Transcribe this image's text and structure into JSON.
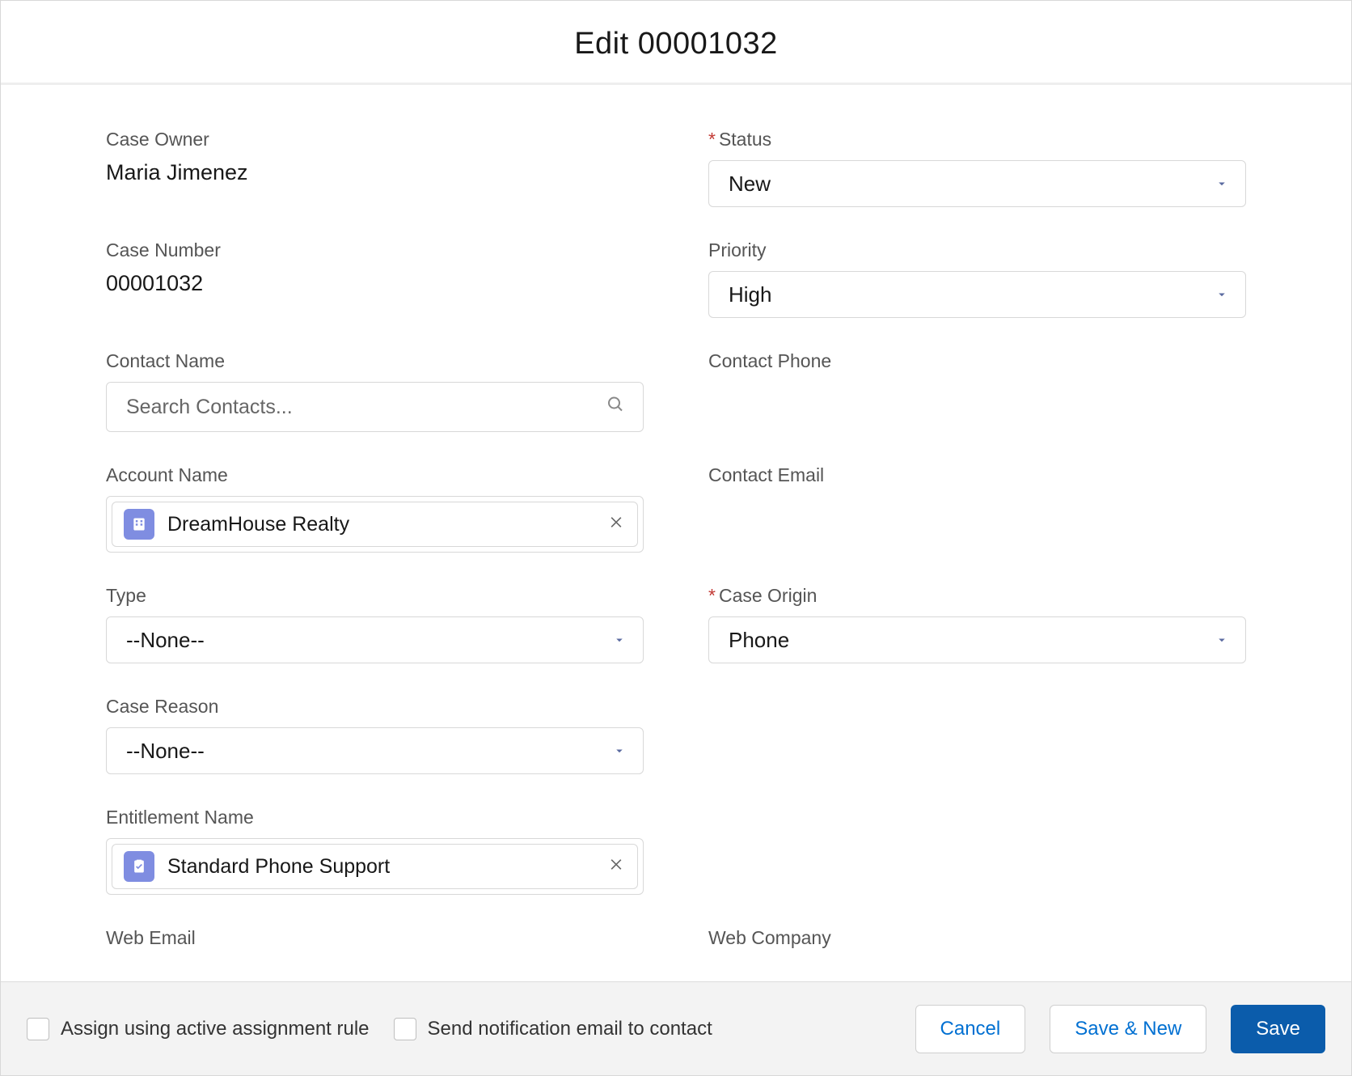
{
  "header": {
    "title": "Edit 00001032"
  },
  "fields": {
    "caseOwner": {
      "label": "Case Owner",
      "value": "Maria Jimenez"
    },
    "status": {
      "label": "Status",
      "value": "New",
      "required": true
    },
    "caseNumber": {
      "label": "Case Number",
      "value": "00001032"
    },
    "priority": {
      "label": "Priority",
      "value": "High"
    },
    "contactName": {
      "label": "Contact Name",
      "placeholder": "Search Contacts..."
    },
    "contactPhone": {
      "label": "Contact Phone",
      "value": ""
    },
    "accountName": {
      "label": "Account Name",
      "value": "DreamHouse Realty"
    },
    "contactEmail": {
      "label": "Contact Email",
      "value": ""
    },
    "type": {
      "label": "Type",
      "value": "--None--"
    },
    "caseOrigin": {
      "label": "Case Origin",
      "value": "Phone",
      "required": true
    },
    "caseReason": {
      "label": "Case Reason",
      "value": "--None--"
    },
    "entitlementName": {
      "label": "Entitlement Name",
      "value": "Standard Phone Support"
    },
    "webEmail": {
      "label": "Web Email",
      "value": ""
    },
    "webCompany": {
      "label": "Web Company",
      "value": ""
    }
  },
  "footer": {
    "assignRule": "Assign using active assignment rule",
    "sendEmail": "Send notification email to contact",
    "cancel": "Cancel",
    "saveNew": "Save & New",
    "save": "Save"
  }
}
